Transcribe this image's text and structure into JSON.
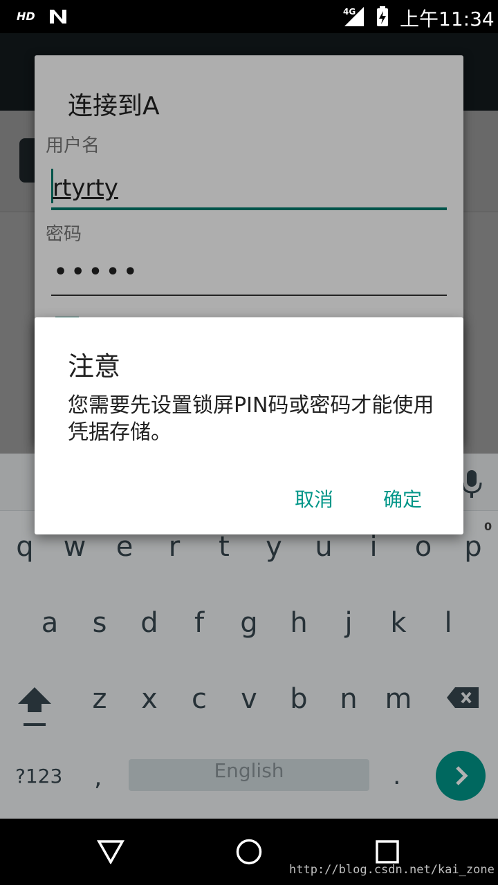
{
  "status_bar": {
    "hd": "HD",
    "network": "4G",
    "clock": "上午11:34"
  },
  "login_dialog": {
    "title": "连接到A",
    "username_label": "用户名",
    "username_value": "rtyrty",
    "password_label": "密码",
    "password_value": "•••••"
  },
  "alert_dialog": {
    "title": "注意",
    "message": "您需要先设置锁屏PIN码或密码才能使用凭据存储。",
    "cancel_label": "取消",
    "ok_label": "确定"
  },
  "keyboard": {
    "row1": [
      "q",
      "w",
      "e",
      "r",
      "t",
      "y",
      "u",
      "i",
      "o",
      "p"
    ],
    "row2": [
      "a",
      "s",
      "d",
      "f",
      "g",
      "h",
      "j",
      "k",
      "l"
    ],
    "row3": [
      "z",
      "x",
      "c",
      "v",
      "b",
      "n",
      "m"
    ],
    "hint_p": "0",
    "symbols_label": "?123",
    "comma": ",",
    "space_label": "English",
    "period": "."
  },
  "watermark": "http://blog.csdn.net/kai_zone",
  "colors": {
    "accent": "#009688",
    "status_bar": "#000000",
    "toolbar": "#1f2a2e"
  }
}
